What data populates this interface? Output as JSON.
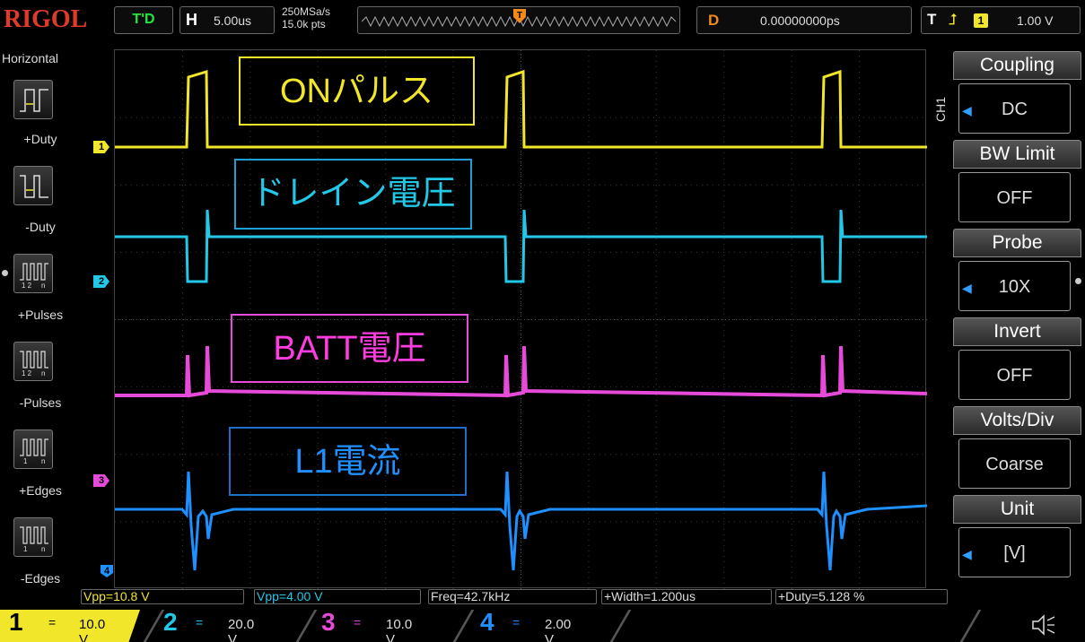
{
  "header": {
    "logo": "RIGOL",
    "status": "T'D",
    "horizontal_key": "H",
    "timebase": "5.00us",
    "sample_rate": "250MSa/s",
    "points": "15.0k pts",
    "delay_key": "D",
    "delay": "0.00000000ps",
    "trigger_key": "T",
    "trigger_edge_icon": "rising-edge-icon",
    "trigger_source": "1",
    "trigger_level": "1.00 V"
  },
  "left_menu": {
    "title": "Horizontal",
    "items": [
      {
        "label": "+Duty",
        "icon": "positive-duty-icon"
      },
      {
        "label": "-Duty",
        "icon": "negative-duty-icon"
      },
      {
        "label": "+Pulses",
        "icon": "positive-pulses-icon",
        "sub": "1 2   n"
      },
      {
        "label": "-Pulses",
        "icon": "negative-pulses-icon",
        "sub": "1 2   n"
      },
      {
        "label": "+Edges",
        "icon": "positive-edges-icon",
        "sub": "1   n"
      },
      {
        "label": "-Edges",
        "icon": "negative-edges-icon",
        "sub": "1   n"
      }
    ]
  },
  "channel_markers": [
    "1",
    "2",
    "3",
    "4"
  ],
  "annotations": [
    {
      "text": "ONパルス",
      "color": "#f2e62a",
      "border": "#f2e62a"
    },
    {
      "text": "ドレイン電圧",
      "color": "#22c8e8",
      "border": "#1e9fd6"
    },
    {
      "text": "BATT電圧",
      "color": "#ff3ce0",
      "border": "#e64ad8"
    },
    {
      "text": "L1電流",
      "color": "#1e90ff",
      "border": "#1f6fc8"
    }
  ],
  "right_menu": {
    "channel_tab": "CH1",
    "items": [
      {
        "title": "Coupling",
        "value": "DC",
        "arrow": true
      },
      {
        "title": "BW Limit",
        "value": "OFF",
        "arrow": false
      },
      {
        "title": "Probe",
        "value": "10X",
        "arrow": true
      },
      {
        "title": "Invert",
        "value": "OFF",
        "arrow": false
      },
      {
        "title": "Volts/Div",
        "value": "Coarse",
        "arrow": false
      },
      {
        "title": "Unit",
        "value": "[V]",
        "arrow": true
      }
    ]
  },
  "measurements": [
    "Vpp=10.8 V",
    "Vpp=4.00 V",
    "Freq=42.7kHz",
    "+Width=1.200us",
    "+Duty=5.128 %"
  ],
  "channels": [
    {
      "num": "1",
      "coupling": "=",
      "scale": "10.0 V",
      "color": "#f2e62a"
    },
    {
      "num": "2",
      "coupling": "=",
      "scale": "20.0 V",
      "color": "#22c8e8"
    },
    {
      "num": "3",
      "coupling": "=",
      "scale": "10.0 V",
      "color": "#e64ad8"
    },
    {
      "num": "4",
      "coupling": "=",
      "scale": "2.00 V",
      "color": "#1e90ff"
    }
  ],
  "speaker_icon": "speaker-icon"
}
